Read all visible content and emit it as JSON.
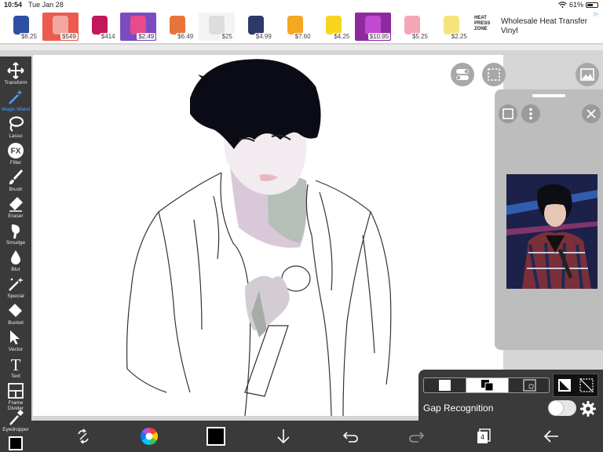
{
  "status": {
    "time": "10:54",
    "date": "Tue Jan 28",
    "battery": "61%",
    "battery_level": 0.61
  },
  "ads": {
    "items": [
      {
        "price": "$6.25",
        "color": "#ffffff",
        "thumb": "#2e4fa3"
      },
      {
        "price": "$549",
        "color": "#ee5a4e",
        "thumb": "#f3a7a0"
      },
      {
        "price": "$414",
        "color": "#ffffff",
        "thumb": "#c2185b"
      },
      {
        "price": "$2.49",
        "color": "#7b4cc0",
        "thumb": "#e84b8a"
      },
      {
        "price": "$6.49",
        "color": "#ffffff",
        "thumb": "#e8743b"
      },
      {
        "price": "$25",
        "color": "#f4f4f4",
        "thumb": "#dddddd"
      },
      {
        "price": "$4.99",
        "color": "#ffffff",
        "thumb": "#2b3a66"
      },
      {
        "price": "$7.60",
        "color": "#ffffff",
        "thumb": "#f5a623"
      },
      {
        "price": "$4.25",
        "color": "#ffffff",
        "thumb": "#f7d51d"
      },
      {
        "price": "$10.95",
        "color": "#8e2aa0",
        "thumb": "#c04ad0"
      },
      {
        "price": "$5.25",
        "color": "#ffffff",
        "thumb": "#f3a6b6"
      },
      {
        "price": "$2.25",
        "color": "#ffffff",
        "thumb": "#f5e47a"
      }
    ],
    "headline": "Wholesale Heat Transfer Vinyl",
    "brand": "HEAT PRESS ZONE"
  },
  "tools": [
    {
      "label": "Transform",
      "icon": "transform-icon"
    },
    {
      "label": "Magic Wand",
      "icon": "magic-wand-icon",
      "active": true
    },
    {
      "label": "Lasso",
      "icon": "lasso-icon"
    },
    {
      "label": "Filter",
      "icon": "filter-icon"
    },
    {
      "label": "Brush",
      "icon": "brush-icon"
    },
    {
      "label": "Eraser",
      "icon": "eraser-icon"
    },
    {
      "label": "Smudge",
      "icon": "smudge-icon"
    },
    {
      "label": "Blur",
      "icon": "blur-icon"
    },
    {
      "label": "Special",
      "icon": "special-icon"
    },
    {
      "label": "Bucket",
      "icon": "bucket-icon"
    },
    {
      "label": "Vector",
      "icon": "vector-icon"
    },
    {
      "label": "Text",
      "icon": "text-icon"
    },
    {
      "label": "Frame Divider",
      "icon": "frame-divider-icon"
    },
    {
      "label": "Eyedropper",
      "icon": "eyedropper-icon"
    }
  ],
  "filter_glyph": "FX",
  "text_glyph": "T",
  "bottom": {
    "layer_count": "4",
    "current_color": "#000000"
  },
  "gap_recognition": {
    "label": "Gap Recognition",
    "enabled": false
  },
  "colors": {
    "accent": "#4aa3ff",
    "toolbar": "#3a3a3a"
  }
}
